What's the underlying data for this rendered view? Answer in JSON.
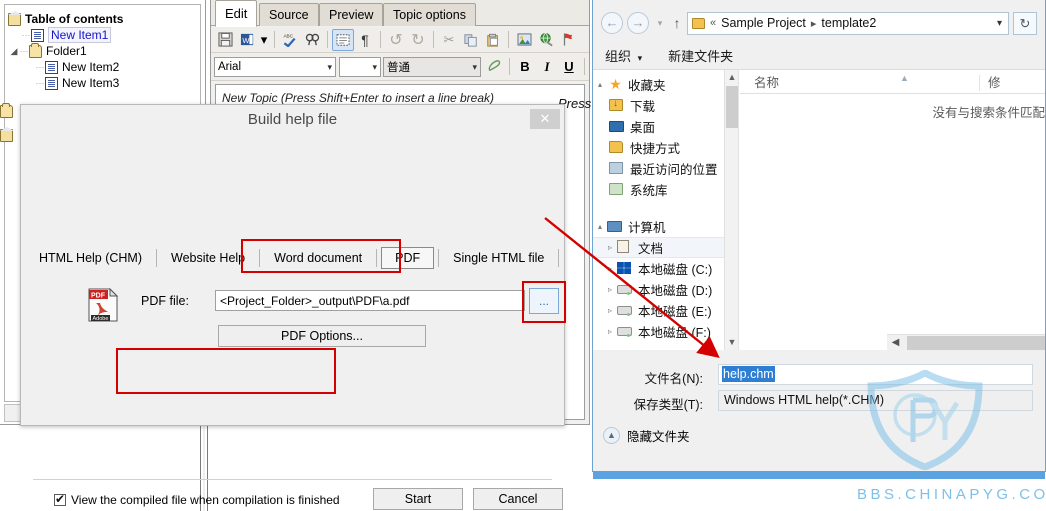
{
  "toc": {
    "title": "Table of contents",
    "items": [
      {
        "label": "New Item1",
        "icon": "document-icon",
        "level": 1,
        "selected": true
      },
      {
        "label": "Folder1",
        "icon": "folder-icon",
        "level": 1,
        "selected": false
      },
      {
        "label": "New Item2",
        "icon": "document-icon",
        "level": 2,
        "selected": false
      },
      {
        "label": "New Item3",
        "icon": "document-icon",
        "level": 2,
        "selected": false
      }
    ]
  },
  "editor": {
    "tabs": [
      {
        "label": "Edit",
        "active": true
      },
      {
        "label": "Source",
        "active": false
      },
      {
        "label": "Preview",
        "active": false
      },
      {
        "label": "Topic options",
        "active": false
      }
    ],
    "toolbar_icons": [
      "save-icon",
      "word-export-icon",
      "dropdown-arrow-icon",
      "spellcheck-icon",
      "find-icon",
      "select-region-icon",
      "paragraph-mark-icon",
      "undo-icon",
      "redo-icon",
      "cut-icon",
      "copy-icon",
      "paste-icon",
      "insert-image-icon",
      "insert-link-icon",
      "bookmark-icon"
    ],
    "font_name": "Arial",
    "font_size": "",
    "style_name": "普通",
    "format_buttons": [
      "clear-format-icon",
      "B",
      "I",
      "U",
      "align-icon"
    ],
    "body_text": "New Topic (Press Shift+Enter to insert a line break)",
    "body_text_right": "Press"
  },
  "build_dialog": {
    "title": "Build help file",
    "close_label": "✕",
    "tabs": [
      {
        "label": "HTML Help (CHM)",
        "selected": false
      },
      {
        "label": "Website Help",
        "selected": false
      },
      {
        "label": "Word document",
        "selected": false
      },
      {
        "label": "PDF",
        "selected": true
      },
      {
        "label": "Single HTML file",
        "selected": false
      }
    ],
    "pdf_icon_label_top": "PDF",
    "pdf_icon_label_bottom": "Adobe",
    "file_label": "PDF file:",
    "file_value": "<Project_Folder>_output\\PDF\\a.pdf",
    "browse_label": "...",
    "options_label": "PDF Options...",
    "view_checkbox_label": "View the compiled file when compilation is finished",
    "view_checkbox_checked": true,
    "start_label": "Start",
    "cancel_label": "Cancel"
  },
  "explorer": {
    "back_icon": "back-arrow-icon",
    "forward_icon": "forward-arrow-icon",
    "history_icon": "history-dropdown-icon",
    "up_icon": "up-arrow-icon",
    "breadcrumb": {
      "prefix": "«",
      "parts": [
        "Sample Project",
        "template2"
      ]
    },
    "address_dropdown_icon": "chevron-down-icon",
    "refresh_icon": "refresh-icon",
    "toolbar": [
      {
        "label": "组织",
        "has_arrow": true
      },
      {
        "label": "新建文件夹",
        "has_arrow": false
      }
    ],
    "tree": [
      {
        "label": "收藏夹",
        "icon": "star-icon",
        "level": 0,
        "twisty": "▴",
        "selected": false
      },
      {
        "label": "下载",
        "icon": "downloads-icon",
        "level": 1,
        "twisty": "",
        "selected": false
      },
      {
        "label": "桌面",
        "icon": "desktop-icon",
        "level": 1,
        "twisty": "",
        "selected": false
      },
      {
        "label": "快捷方式",
        "icon": "folder-icon",
        "level": 1,
        "twisty": "",
        "selected": false
      },
      {
        "label": "最近访问的位置",
        "icon": "recent-places-icon",
        "level": 1,
        "twisty": "",
        "selected": false
      },
      {
        "label": "系统库",
        "icon": "library-icon",
        "level": 1,
        "twisty": "",
        "selected": false
      },
      {
        "label": "计算机",
        "icon": "computer-icon",
        "level": 0,
        "twisty": "▴",
        "selected": false
      },
      {
        "label": "文档",
        "icon": "documents-icon",
        "level": 1,
        "twisty": "▹",
        "selected": true
      },
      {
        "label": "本地磁盘 (C:)",
        "icon": "windows-drive-icon",
        "level": 1,
        "twisty": "▹",
        "selected": false
      },
      {
        "label": "本地磁盘 (D:)",
        "icon": "drive-icon",
        "level": 1,
        "twisty": "▹",
        "selected": false
      },
      {
        "label": "本地磁盘 (E:)",
        "icon": "drive-icon",
        "level": 1,
        "twisty": "▹",
        "selected": false
      },
      {
        "label": "本地磁盘 (F:)",
        "icon": "drive-icon",
        "level": 1,
        "twisty": "▹",
        "selected": false
      }
    ],
    "columns": [
      {
        "label": "名称",
        "sorted": true
      },
      {
        "label": "修",
        "sorted": false
      }
    ],
    "empty_message": "没有与搜索条件匹配",
    "file_name_label": "文件名(N):",
    "file_name_value": "help.chm",
    "save_type_label": "保存类型(T):",
    "save_type_value": "Windows HTML help(*.CHM)",
    "hide_folders_label": "隐藏文件夹",
    "hide_folders_icon": "collapse-icon"
  },
  "watermark": {
    "text": "BBS.CHINAPYG.COM",
    "monogram": "CPY",
    "color": "#7fc0e8"
  },
  "annotations": {
    "highlight_color": "#d40000",
    "arrow_from": "browse-button",
    "arrow_to": "file-name-field"
  }
}
